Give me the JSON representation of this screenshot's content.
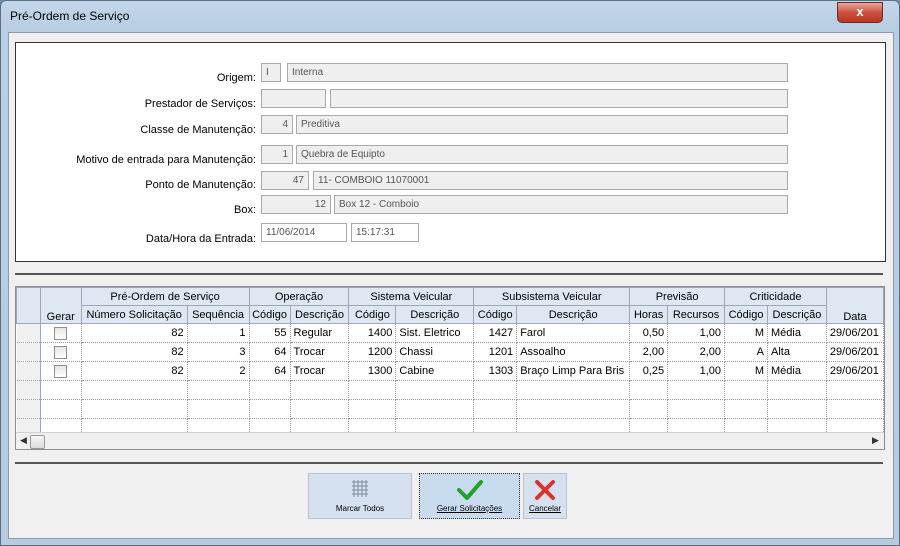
{
  "window": {
    "title": "Pré-Ordem de Serviço",
    "close_label": "x"
  },
  "form": {
    "origem": {
      "label": "Origem:",
      "code": "I",
      "desc": "Interna"
    },
    "prestador": {
      "label": "Prestador de Serviços:",
      "code": "",
      "desc": ""
    },
    "classe": {
      "label": "Classe de Manutenção:",
      "code": "4",
      "desc": "Preditiva"
    },
    "motivo": {
      "label": "Motivo de entrada para Manutenção:",
      "code": "1",
      "desc": "Quebra de Equipto"
    },
    "ponto": {
      "label": "Ponto de Manutenção:",
      "code": "47",
      "desc": "11- COMBOIO 11070001"
    },
    "box": {
      "label": "Box:",
      "code": "12",
      "desc": "Box 12 - Comboio"
    },
    "datahora": {
      "label": "Data/Hora da Entrada:",
      "date": "11/06/2014",
      "time": "15:17:31"
    }
  },
  "grid": {
    "groups": {
      "preordem": "Pré-Ordem de Serviço",
      "operacao": "Operação",
      "sistema": "Sistema Veicular",
      "subsistema": "Subsistema Veicular",
      "previsao": "Previsão",
      "criticidade": "Criticidade"
    },
    "columns": [
      "Gerar",
      "Número Solicitação",
      "Sequência",
      "Código",
      "Descrição",
      "Código",
      "Descrição",
      "Código",
      "Descrição",
      "Horas",
      "Recursos",
      "Código",
      "Descrição",
      "Data"
    ],
    "rows": [
      [
        "82",
        "1",
        "55",
        "Regular",
        "1400",
        "Sist. Eletrico",
        "1427",
        "Farol",
        "0,50",
        "1,00",
        "M",
        "Média",
        "29/06/201"
      ],
      [
        "82",
        "3",
        "64",
        "Trocar",
        "1200",
        "Chassi",
        "1201",
        "Assoalho",
        "2,00",
        "2,00",
        "A",
        "Alta",
        "29/06/201"
      ],
      [
        "82",
        "2",
        "64",
        "Trocar",
        "1300",
        "Cabine",
        "1303",
        "Braço Limp Para Bris",
        "0,25",
        "1,00",
        "M",
        "Média",
        "29/06/201"
      ]
    ]
  },
  "buttons": {
    "marcar_todos": "Marcar Todos",
    "gerar": "Gerar Solicitações",
    "cancelar": "Cancelar"
  },
  "icons": {
    "marcar": "grid-icon",
    "gerar": "green-check-icon",
    "cancelar": "red-x-icon"
  },
  "colors": {
    "check": "#1fa329",
    "cancel": "#d8322a",
    "header": "#dde8f3"
  }
}
